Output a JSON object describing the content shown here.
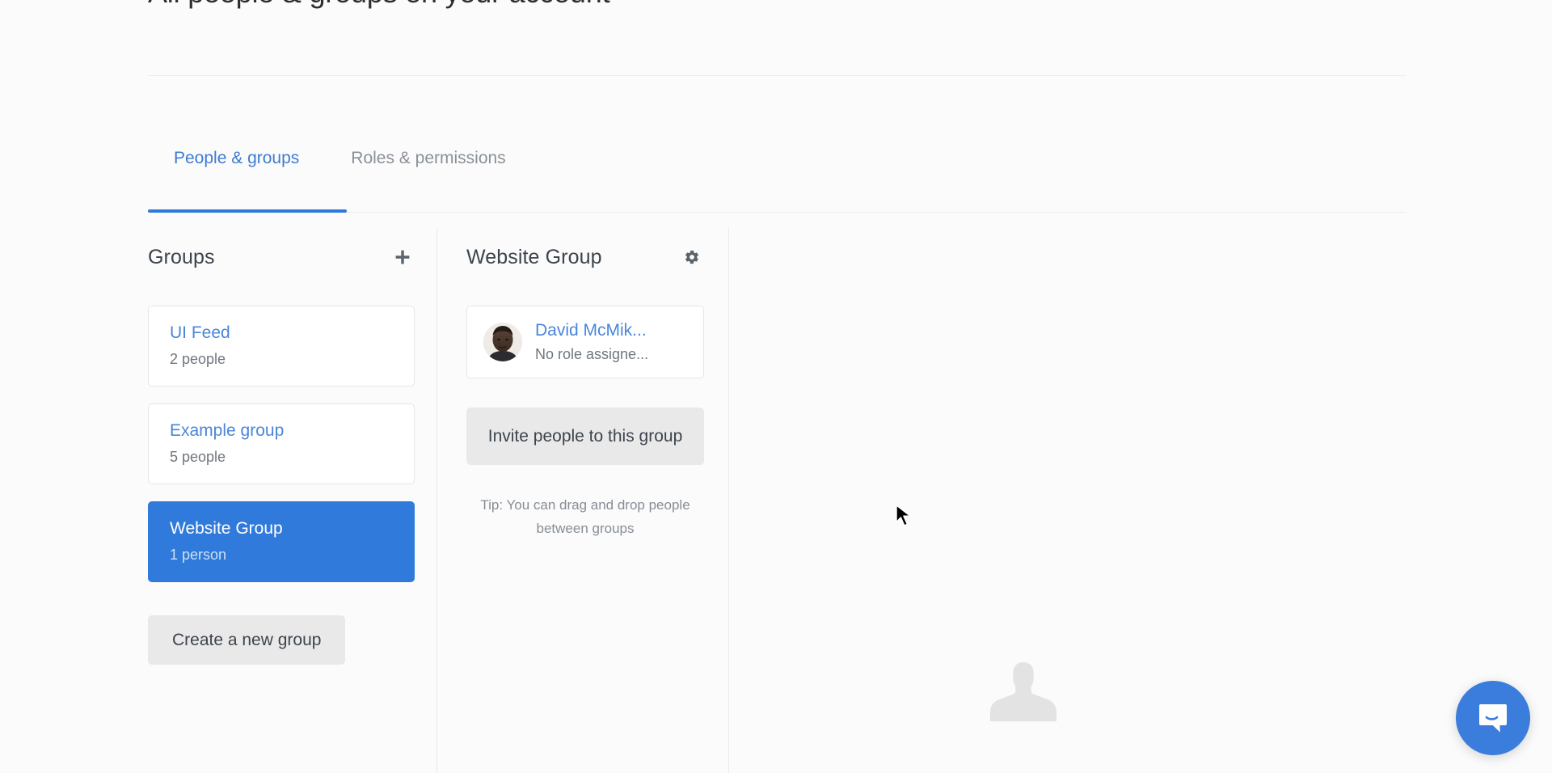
{
  "page": {
    "title": "All people & groups on your account"
  },
  "tabs": [
    {
      "label": "People & groups",
      "active": true
    },
    {
      "label": "Roles & permissions",
      "active": false
    }
  ],
  "groups_panel": {
    "heading": "Groups",
    "add_icon": "plus-icon",
    "groups": [
      {
        "name": "UI Feed",
        "count": "2 people",
        "selected": false
      },
      {
        "name": "Example group",
        "count": "5 people",
        "selected": false
      },
      {
        "name": "Website Group",
        "count": "1 person",
        "selected": true
      }
    ],
    "create_button": "Create a new group"
  },
  "detail_panel": {
    "heading": "Website Group",
    "settings_icon": "gear-icon",
    "members": [
      {
        "name": "David McMik...",
        "role": "No role assigne...",
        "avatar": "person-photo-avatar"
      }
    ],
    "invite_button": "Invite people to this group",
    "tip": "Tip: You can drag and drop people between groups"
  },
  "right_panel": {
    "placeholder_icon": "person-silhouette-icon"
  },
  "messenger": {
    "icon": "chat-bubble-icon"
  },
  "colors": {
    "accent": "#2f7ada",
    "link": "#4a86d8",
    "page_bg": "#fbfbfb",
    "muted_text": "#6f767e",
    "button_bg": "#e9e9e9"
  }
}
